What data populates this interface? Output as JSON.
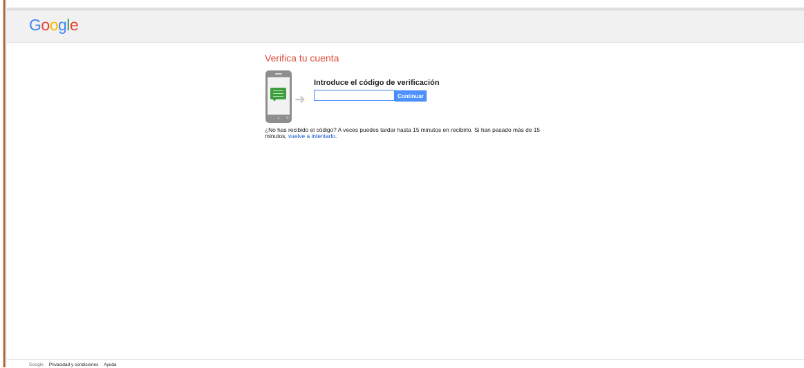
{
  "header": {
    "logo_letters": [
      "G",
      "o",
      "o",
      "g",
      "l",
      "e"
    ]
  },
  "main": {
    "title": "Verifica tu cuenta",
    "form": {
      "label": "Introduce el código de verificación",
      "input_value": "",
      "button_label": "Continuar"
    },
    "help": {
      "text": "¿No has recibido el código? A veces puedes tardar hasta 15 minutos en recibirlo. Si han pasado más de 15 minutos,",
      "link_text": "vuelve a intentarlo",
      "suffix": "."
    }
  },
  "footer": {
    "brand": "Google",
    "links": [
      "Privacidad y condiciones",
      "Ayuda"
    ]
  },
  "colors": {
    "title": "#dd4b39",
    "button": "#4d90fe",
    "link": "#1155cc",
    "header_bg": "#f1f1f1"
  },
  "icons": {
    "phone": "phone-sms-icon",
    "arrow": "arrow-right-icon"
  }
}
